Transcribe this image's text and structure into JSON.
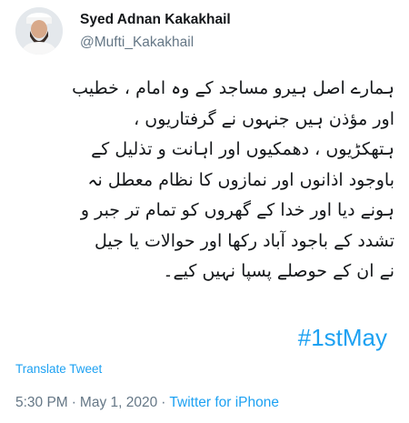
{
  "author": {
    "display_name": "Syed Adnan Kakakhail",
    "handle": "@Mufti_Kakakhail",
    "avatar_icon": "profile-photo"
  },
  "tweet": {
    "lines": [
      "ہمارے اصل ہیرو مساجد کے وہ امام ، خطیب",
      "اور مؤذن ہیں جنہوں نے گرفتاریوں ،",
      "ہتھکڑیوں ، دھمکیوں اور اہانت و تذلیل کے",
      "باوجود اذانوں اور نمازوں کا نظام معطل نہ",
      "ہونے دیا اور خدا کے گھروں کو تمام تر جبر و",
      "تشدد کے باجود آباد رکھا اور حوالات یا جیل",
      "نے ان کے حوصلے پسپا نہیں کیے۔"
    ],
    "hashtag": "#1stMay",
    "translate_label": "Translate Tweet"
  },
  "meta": {
    "time": "5:30 PM",
    "separator": "·",
    "date": "May 1, 2020",
    "source": "Twitter for iPhone"
  },
  "colors": {
    "link": "#1da1f2",
    "secondary_text": "#657786",
    "primary_text": "#14171a"
  }
}
